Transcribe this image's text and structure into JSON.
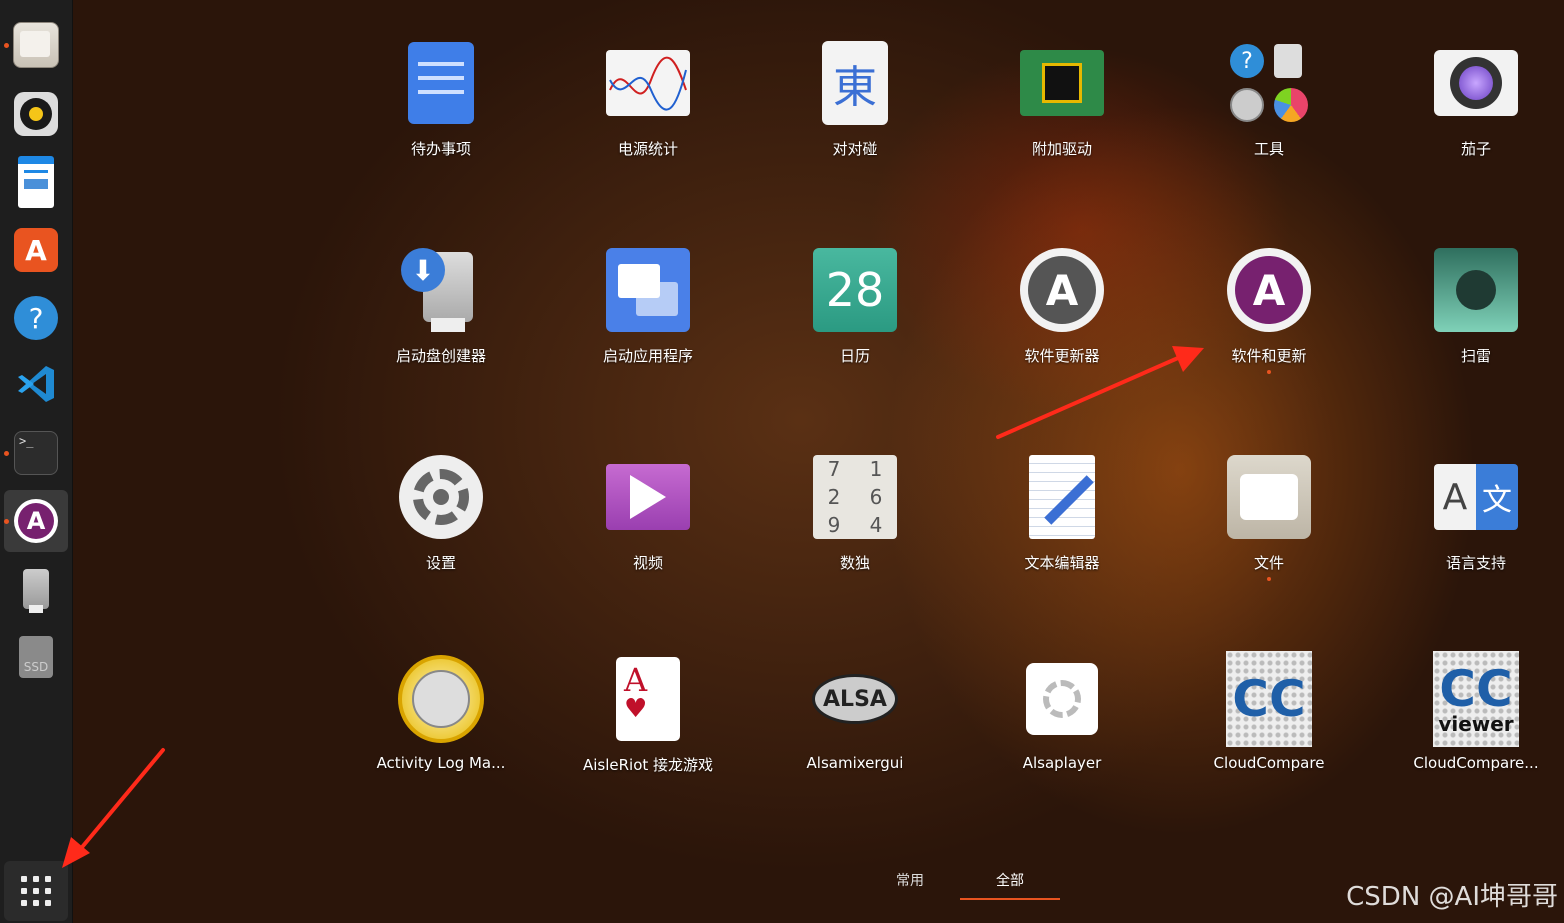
{
  "dock": {
    "items": [
      {
        "name": "files-icon",
        "running": true
      },
      {
        "name": "rhythmbox-icon",
        "running": false
      },
      {
        "name": "libreoffice-writer-icon",
        "running": false
      },
      {
        "name": "ubuntu-software-icon",
        "running": false
      },
      {
        "name": "help-icon",
        "running": false
      },
      {
        "name": "vscode-icon",
        "running": false
      },
      {
        "name": "terminal-icon",
        "running": true
      },
      {
        "name": "software-updater-icon",
        "running": true,
        "active": true
      },
      {
        "name": "usb-drive-icon",
        "running": false
      },
      {
        "name": "ssd-drive-icon",
        "running": false,
        "text": "SSD"
      }
    ],
    "show_apps_icon": "show-applications-icon"
  },
  "apps": [
    {
      "label": "待办事项",
      "icon": "todo-icon"
    },
    {
      "label": "电源统计",
      "icon": "power-statistics-icon"
    },
    {
      "label": "对对碰",
      "icon": "mahjongg-icon",
      "glyph": "東"
    },
    {
      "label": "附加驱动",
      "icon": "additional-drivers-icon"
    },
    {
      "label": "工具",
      "icon": "utilities-folder-icon"
    },
    {
      "label": "茄子",
      "icon": "cheese-icon"
    },
    {
      "label": "启动盘创建器",
      "icon": "startup-disk-creator-icon"
    },
    {
      "label": "启动应用程序",
      "icon": "startup-applications-icon"
    },
    {
      "label": "日历",
      "icon": "calendar-icon",
      "glyph": "28"
    },
    {
      "label": "软件更新器",
      "icon": "software-updater-icon"
    },
    {
      "label": "软件和更新",
      "icon": "software-properties-icon",
      "running": true
    },
    {
      "label": "扫雷",
      "icon": "mines-icon"
    },
    {
      "label": "设置",
      "icon": "settings-icon"
    },
    {
      "label": "视频",
      "icon": "videos-icon"
    },
    {
      "label": "数独",
      "icon": "sudoku-icon",
      "glyph_cells": [
        "7",
        "1",
        "2",
        "6",
        "9",
        "4"
      ]
    },
    {
      "label": "文本编辑器",
      "icon": "text-editor-icon"
    },
    {
      "label": "文件",
      "icon": "files-icon",
      "running": true
    },
    {
      "label": "语言支持",
      "icon": "language-support-icon",
      "glyph_a": "A",
      "glyph_b": "文"
    },
    {
      "label": "Activity Log Ma...",
      "icon": "activity-log-icon"
    },
    {
      "label": "AisleRiot 接龙游戏",
      "icon": "aisleriot-icon",
      "glyph": "A"
    },
    {
      "label": "Alsamixergui",
      "icon": "alsamixergui-icon",
      "glyph": "ALSA"
    },
    {
      "label": "Alsaplayer",
      "icon": "alsaplayer-icon"
    },
    {
      "label": "CloudCompare",
      "icon": "cloudcompare-icon",
      "glyph": "CC"
    },
    {
      "label": "CloudCompare...",
      "icon": "ccviewer-icon",
      "glyph": "CC",
      "sub": "viewer"
    }
  ],
  "tabs": [
    {
      "label": "常用",
      "selected": false
    },
    {
      "label": "全部",
      "selected": true
    }
  ],
  "watermark": "CSDN @AI坤哥哥",
  "colors": {
    "accent": "#e95420",
    "dock_bg": "#1e1e1e",
    "annotation_arrow": "#ff2a1a"
  }
}
